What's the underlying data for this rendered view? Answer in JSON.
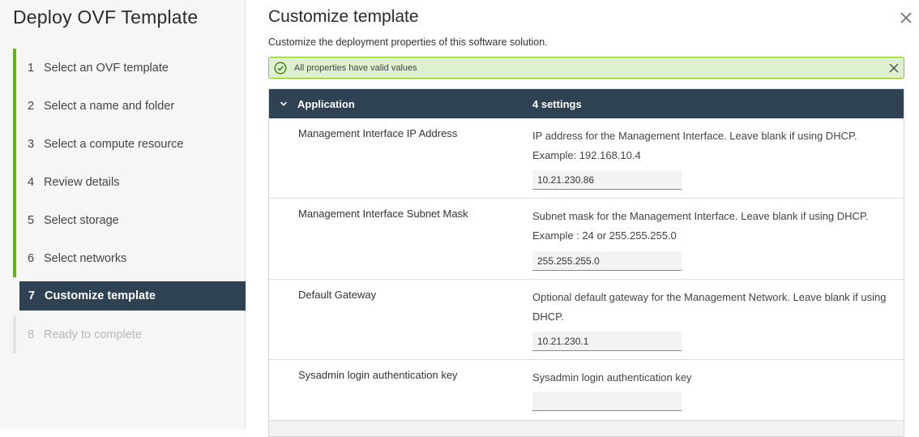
{
  "wizard": {
    "title": "Deploy OVF Template",
    "steps": [
      {
        "num": "1",
        "label": "Select an OVF template"
      },
      {
        "num": "2",
        "label": "Select a name and folder"
      },
      {
        "num": "3",
        "label": "Select a compute resource"
      },
      {
        "num": "4",
        "label": "Review details"
      },
      {
        "num": "5",
        "label": "Select storage"
      },
      {
        "num": "6",
        "label": "Select networks"
      },
      {
        "num": "7",
        "label": "Customize template"
      },
      {
        "num": "8",
        "label": "Ready to complete"
      }
    ]
  },
  "page": {
    "title": "Customize template",
    "subtitle": "Customize the deployment properties of this software solution."
  },
  "alert": {
    "message": "All properties have valid values"
  },
  "group": {
    "name": "Application",
    "count": "4 settings"
  },
  "properties": [
    {
      "label": "Management Interface IP Address",
      "description": "IP address for the Management Interface. Leave blank if using DHCP. Example: 192.168.10.4",
      "value": "10.21.230.86"
    },
    {
      "label": "Management Interface Subnet Mask",
      "description": "Subnet mask for the Management Interface. Leave blank if using DHCP. Example : 24 or 255.255.255.0",
      "value": "255.255.255.0"
    },
    {
      "label": "Default Gateway",
      "description": "Optional default gateway for the Management Network. Leave blank if using DHCP.",
      "value": "10.21.230.1"
    },
    {
      "label": "Sysadmin login authentication key",
      "description": "Sysadmin login authentication key",
      "value": ""
    }
  ],
  "colors": {
    "completed_step": "#5eb715",
    "active_step_bg": "#2e4253",
    "alert_bg": "#dff0d0",
    "alert_border": "#85c81a"
  },
  "icons": {
    "close": "close-icon",
    "success": "check-circle-icon",
    "dismiss": "close-icon",
    "collapse": "chevron-down-icon"
  }
}
